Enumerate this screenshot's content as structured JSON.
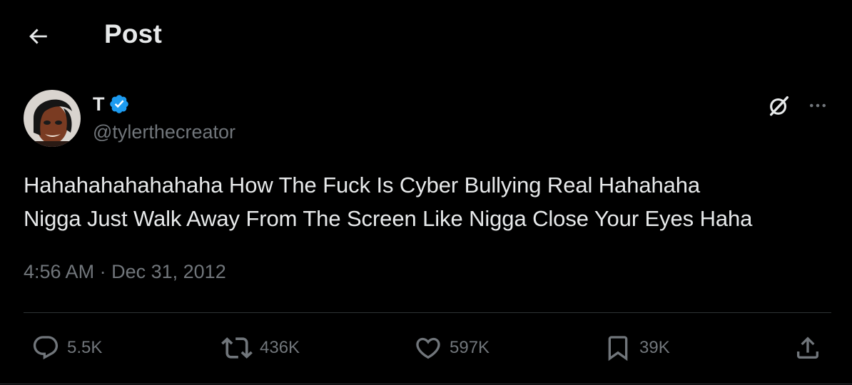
{
  "header": {
    "title": "Post"
  },
  "author": {
    "name": "T",
    "handle": "@tylerthecreator",
    "verified": true
  },
  "tweet": {
    "text_line1": "Hahahahahahahaha How The Fuck Is Cyber Bullying Real Hahahaha",
    "text_line2": "Nigga Just Walk Away From The Screen Like Nigga Close Your Eyes Haha",
    "time": "4:56 AM",
    "separator": "·",
    "date": "Dec 31, 2012"
  },
  "actions": {
    "replies": "5.5K",
    "reposts": "436K",
    "likes": "597K",
    "bookmarks": "39K"
  },
  "icons": {
    "back": "arrow-left-icon",
    "verified": "verified-badge-icon",
    "grok": "grok-icon",
    "more": "more-icon",
    "reply": "reply-icon",
    "repost": "repost-icon",
    "like": "heart-icon",
    "bookmark": "bookmark-icon",
    "share": "share-icon"
  },
  "colors": {
    "background": "#000000",
    "text_primary": "#e7e9ea",
    "text_secondary": "#71767b",
    "verified": "#1d9bf0",
    "divider": "#2f3336"
  }
}
